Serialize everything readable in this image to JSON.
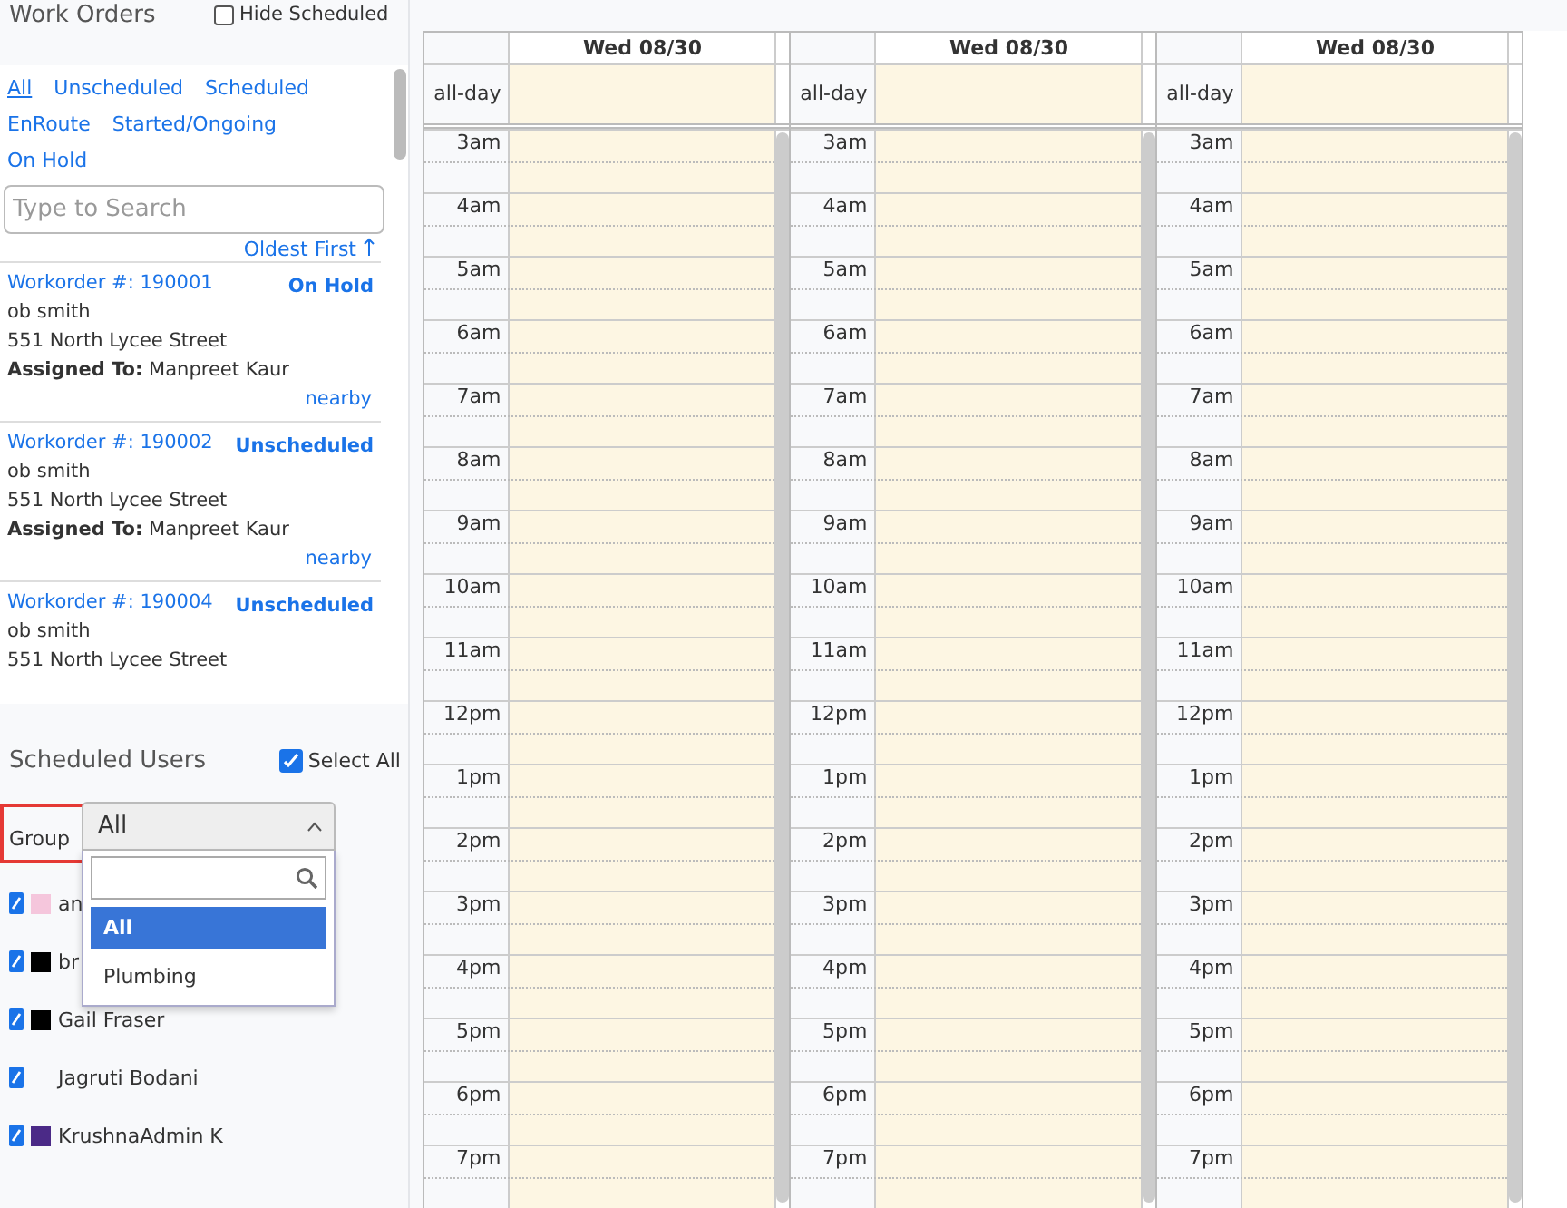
{
  "work_orders": {
    "title": "Work Orders",
    "hide_scheduled": {
      "label": "Hide Scheduled",
      "checked": false
    },
    "filters": [
      {
        "label": "All",
        "selected": true
      },
      {
        "label": "Unscheduled",
        "selected": false
      },
      {
        "label": "Scheduled",
        "selected": false
      },
      {
        "label": "EnRoute",
        "selected": false
      },
      {
        "label": "Started/Ongoing",
        "selected": false
      },
      {
        "label": "On Hold",
        "selected": false
      }
    ],
    "search": {
      "placeholder": "Type to Search"
    },
    "sort": "Oldest First",
    "items": [
      {
        "number": "Workorder #: 190001",
        "status": "On Hold",
        "customer": "ob smith",
        "address": "551 North Lycee Street",
        "assigned_label": "Assigned To:",
        "assigned": "Manpreet Kaur",
        "link": "nearby"
      },
      {
        "number": "Workorder #: 190002",
        "status": "Unscheduled",
        "customer": "ob smith",
        "address": "551 North Lycee Street",
        "assigned_label": "Assigned To:",
        "assigned": "Manpreet Kaur",
        "link": "nearby"
      },
      {
        "number": "Workorder #: 190004",
        "status": "Unscheduled",
        "customer": "ob smith",
        "address": "551 North Lycee Street"
      }
    ]
  },
  "scheduled_users": {
    "title": "Scheduled Users",
    "select_all": {
      "label": "Select All",
      "checked": true
    },
    "group": {
      "label": "Group",
      "value": "All",
      "expanded": true,
      "options": [
        {
          "label": "All",
          "selected": true
        },
        {
          "label": "Plumbing",
          "selected": false
        }
      ]
    },
    "users": [
      {
        "name": "an",
        "checked": true,
        "color": "#f5c6dc"
      },
      {
        "name": "br",
        "checked": true,
        "color": "#000000"
      },
      {
        "name": "Gail Fraser",
        "checked": true,
        "color": "#000000"
      },
      {
        "name": "Jagruti Bodani",
        "checked": true
      },
      {
        "name": "KrushnaAdmin K",
        "checked": true,
        "color": "#4b2a87"
      }
    ]
  },
  "calendar": {
    "columns": [
      {
        "date": "Wed 08/30",
        "allday_label": "all-day",
        "hours": [
          "3am",
          "4am",
          "5am",
          "6am",
          "7am",
          "8am",
          "9am",
          "10am",
          "11am",
          "12pm",
          "1pm",
          "2pm",
          "3pm",
          "4pm",
          "5pm",
          "6pm",
          "7pm"
        ]
      },
      {
        "date": "Wed 08/30",
        "allday_label": "all-day",
        "hours": [
          "3am",
          "4am",
          "5am",
          "6am",
          "7am",
          "8am",
          "9am",
          "10am",
          "11am",
          "12pm",
          "1pm",
          "2pm",
          "3pm",
          "4pm",
          "5pm",
          "6pm",
          "7pm"
        ]
      },
      {
        "date": "Wed 08/30",
        "allday_label": "all-day",
        "hours": [
          "3am",
          "4am",
          "5am",
          "6am",
          "7am",
          "8am",
          "9am",
          "10am",
          "11am",
          "12pm",
          "1pm",
          "2pm",
          "3pm",
          "4pm",
          "5pm",
          "6pm",
          "7pm"
        ]
      }
    ]
  }
}
